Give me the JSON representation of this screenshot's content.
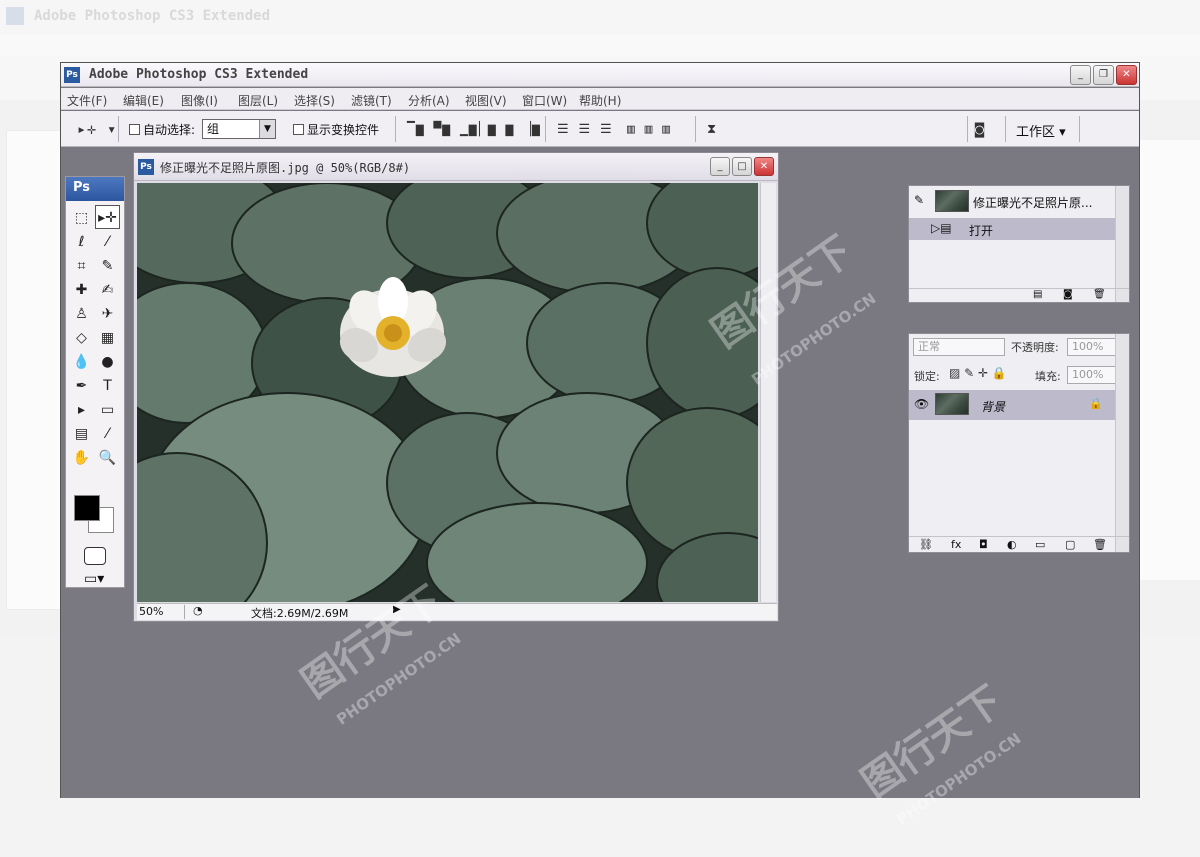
{
  "app": {
    "title": "Adobe Photoshop CS3 Extended",
    "logo": "Ps"
  },
  "menu": [
    {
      "label": "文件(F)"
    },
    {
      "label": "编辑(E)"
    },
    {
      "label": "图像(I)"
    },
    {
      "label": "图层(L)"
    },
    {
      "label": "选择(S)"
    },
    {
      "label": "滤镜(T)"
    },
    {
      "label": "分析(A)"
    },
    {
      "label": "视图(V)"
    },
    {
      "label": "窗口(W)"
    },
    {
      "label": "帮助(H)"
    }
  ],
  "options": {
    "auto_select_label": "自动选择:",
    "auto_select_value": "组",
    "show_transform_label": "显示变换控件",
    "workspace_label": "工作区"
  },
  "toolbox": {
    "header": "Ps"
  },
  "document": {
    "title": "修正曝光不足照片原图.jpg @ 50%(RGB/8#)",
    "zoom": "50%",
    "doc_size": "文档:2.69M/2.69M"
  },
  "history": {
    "snapshot_label": "修正曝光不足照片原...",
    "state_label": "打开"
  },
  "layers": {
    "blend_mode": "正常",
    "opacity_label": "不透明度:",
    "opacity_value": "100%",
    "lock_label": "锁定:",
    "fill_label": "填充:",
    "fill_value": "100%",
    "layer_name": "背景"
  },
  "watermark": {
    "brand": "图行天下",
    "domain": "PHOTOPHOTO.CN"
  }
}
